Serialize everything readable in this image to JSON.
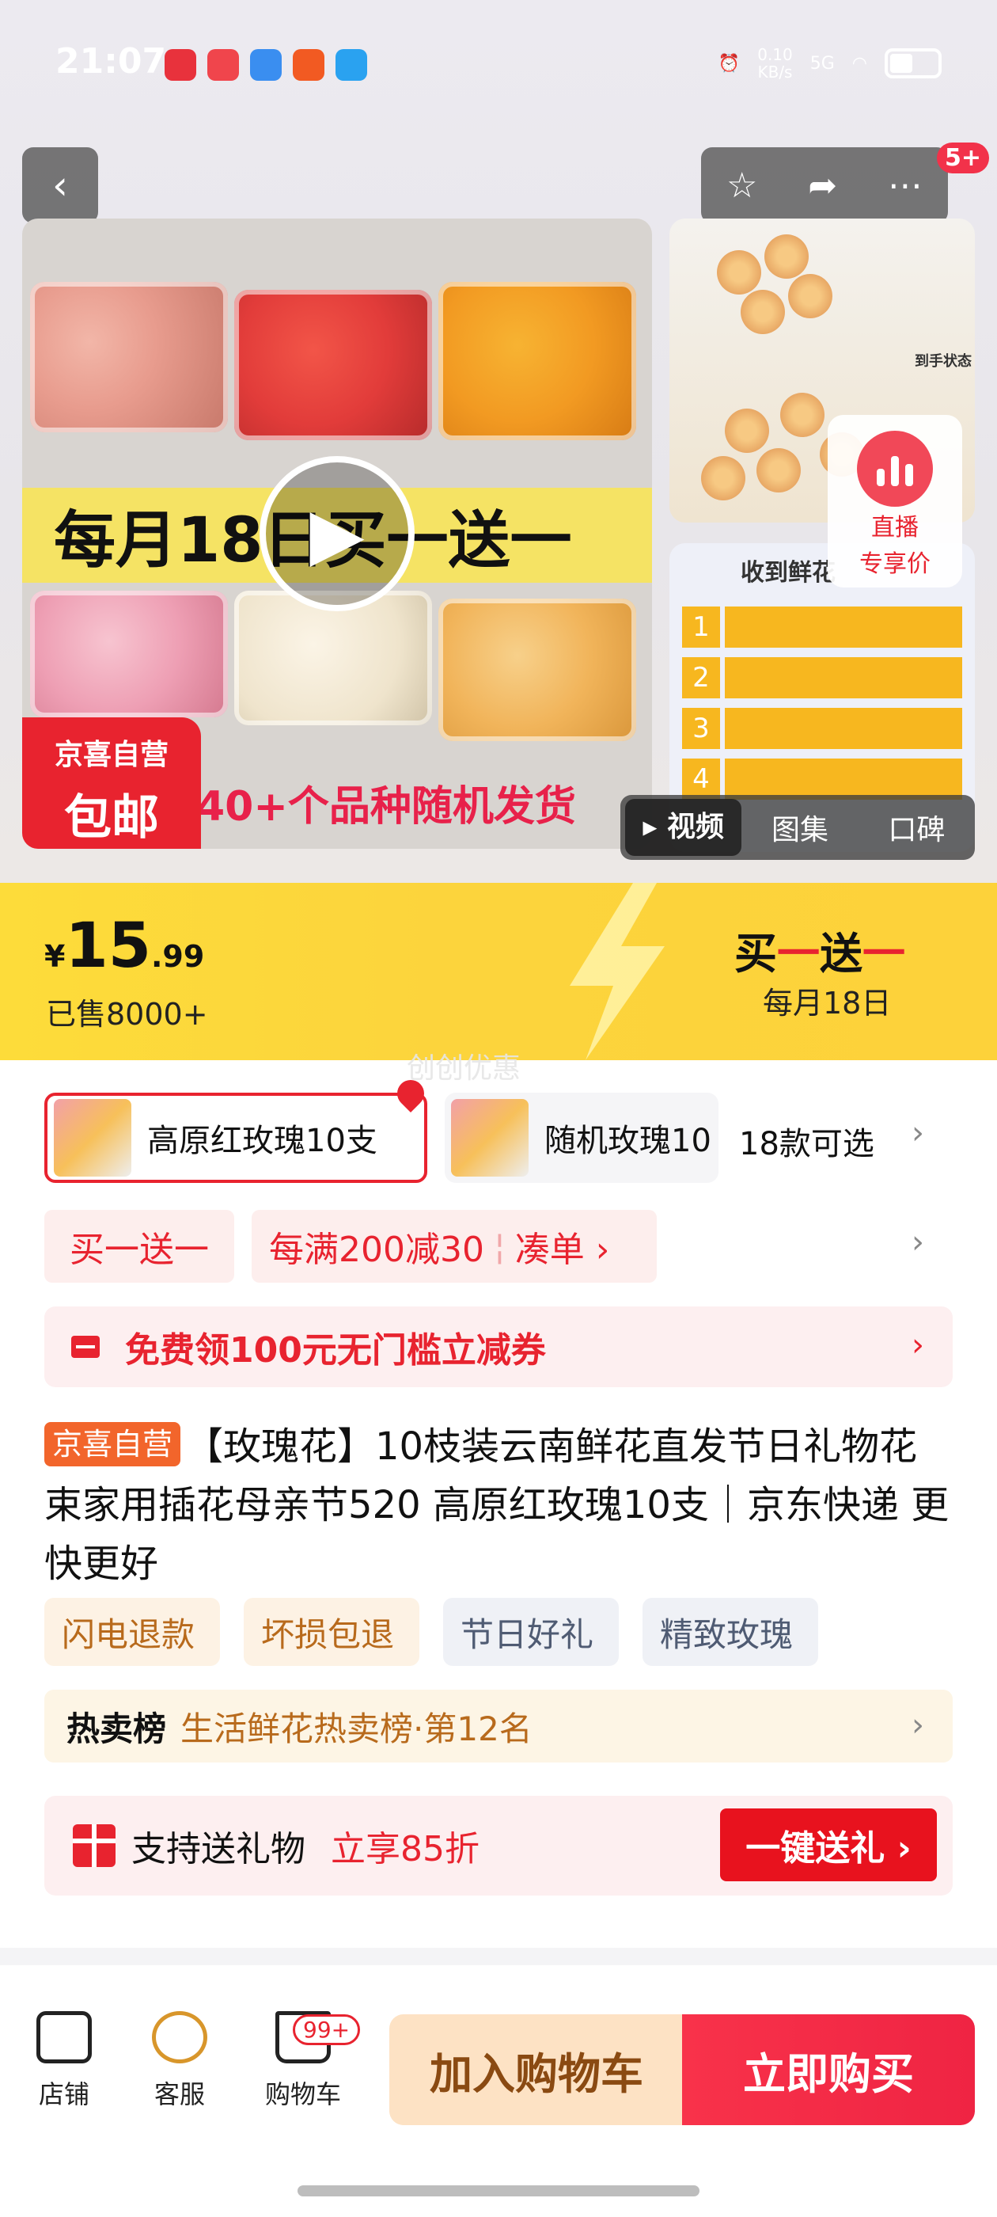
{
  "status_bar": {
    "time": "21:07",
    "network_speed": "0.10\nKB/s",
    "signal": "5G"
  },
  "gallery": {
    "more_badge": "5+",
    "banner_text": "每月18日买一送一",
    "subtitle_text": "40+个品种随机发货",
    "self_operated_tag": {
      "line1": "京喜自营",
      "line2": "包邮"
    },
    "thumb1_note": "到手状态",
    "thumb2_title": "收到鲜花",
    "live": {
      "line1": "直播",
      "line2": "专享价"
    },
    "media_tabs": [
      "视频",
      "图集",
      "口碑"
    ]
  },
  "price": {
    "currency": "¥",
    "integer": "15",
    "decimal": ".99",
    "sold": "已售8000+",
    "promo_black": "买",
    "promo_red1": "一",
    "promo_mid": "送",
    "promo_red2": "一",
    "promo_date": "每月18日",
    "watermark": "创创优惠"
  },
  "variants": {
    "items": [
      {
        "label": "高原红玫瑰10支",
        "selected": true
      },
      {
        "label": "随机玫瑰10",
        "selected": false
      }
    ],
    "count_label": "18款可选"
  },
  "promotions": {
    "tag1": "买一送一",
    "tag2_main": "每满200减30",
    "tag2_action": "凑单 ›"
  },
  "coupon": {
    "label": "免费领100元无门槛立减券"
  },
  "product": {
    "tag": "京喜自营",
    "title": "【玫瑰花】10枝装云南鲜花直发节日礼物花束家用插花母亲节520 高原红玫瑰10支｜京东快递 更快更好",
    "features": [
      "闪电退款",
      "坏损包退",
      "节日好礼",
      "精致玫瑰"
    ]
  },
  "ranking": {
    "label": "热卖榜",
    "value": "生活鲜花热卖榜·第12名"
  },
  "gift": {
    "label": "支持送礼物",
    "discount": "立享85折",
    "button": "一键送礼 ›"
  },
  "bottom_bar": {
    "store": "店铺",
    "service": "客服",
    "cart": "购物车",
    "cart_badge": "99+",
    "add_to_cart": "加入购物车",
    "buy_now": "立即购买"
  },
  "colors": {
    "accent_red": "#e8232f",
    "price_banner_yellow": "#fcd43c",
    "orange_tag": "#f2652b"
  }
}
